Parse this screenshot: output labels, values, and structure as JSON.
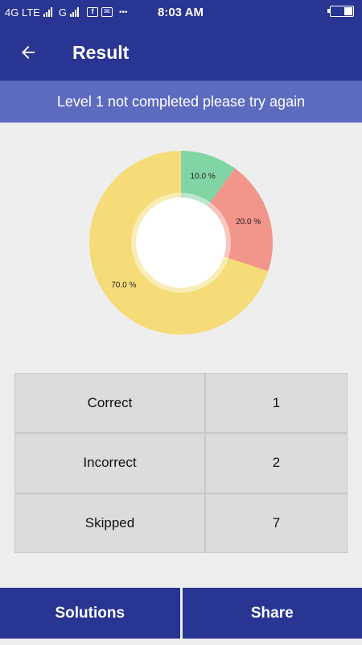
{
  "status_bar": {
    "network_text": "4G LTE",
    "network2_text": "G",
    "time": "8:03 AM",
    "more_dots": "•••",
    "icons": [
      "signal-icon",
      "facebook-icon",
      "mail-icon",
      "battery-charging-icon"
    ]
  },
  "app_bar": {
    "title": "Result",
    "back_icon": "arrow-left-icon"
  },
  "banner": {
    "message": "Level 1 not completed please try again"
  },
  "chart_data": {
    "type": "pie",
    "variant": "donut",
    "slices": [
      {
        "label": "10.0 %",
        "value": 10.0,
        "color": "#81d4a4"
      },
      {
        "label": "20.0 %",
        "value": 20.0,
        "color": "#f2958a"
      },
      {
        "label": "70.0 %",
        "value": 70.0,
        "color": "#f6dc78"
      }
    ],
    "start_angle_deg": 0,
    "direction": "clockwise"
  },
  "stats": {
    "rows": [
      {
        "label": "Correct",
        "value": "1"
      },
      {
        "label": "Incorrect",
        "value": "2"
      },
      {
        "label": "Skipped",
        "value": "7"
      }
    ]
  },
  "bottom_buttons": {
    "solutions_label": "Solutions",
    "share_label": "Share"
  },
  "colors": {
    "primary": "#283593",
    "banner": "#5c6bc0",
    "background": "#eeeeee",
    "cell": "#dcdcdc"
  }
}
